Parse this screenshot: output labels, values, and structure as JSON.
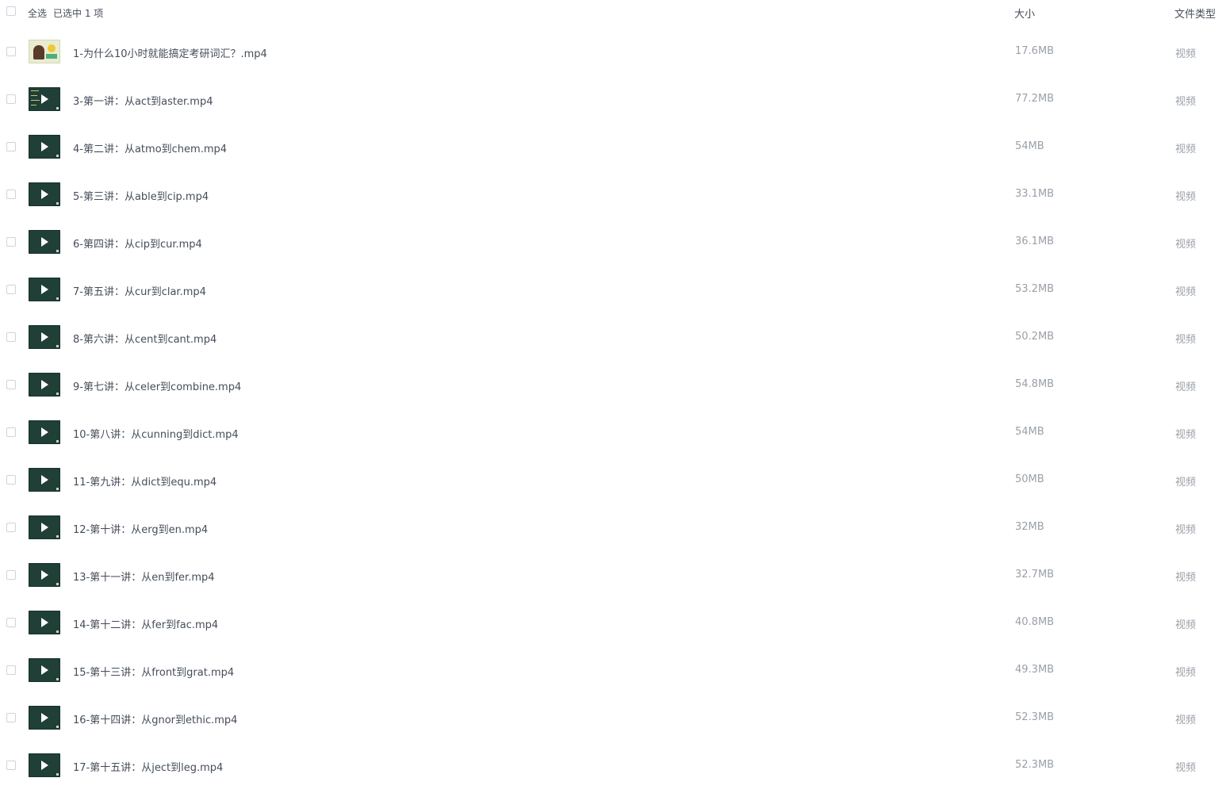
{
  "header": {
    "select_all_label": "全选",
    "selected_text": "已选中  1  项",
    "col_size": "大小",
    "col_type": "文件类型"
  },
  "files": [
    {
      "name": "1-为什么10小时就能搞定考研词汇？.mp4",
      "size": "17.6MB",
      "type": "视频",
      "thumb": "cover"
    },
    {
      "name": "3-第一讲：从act到aster.mp4",
      "size": "77.2MB",
      "type": "视频",
      "thumb": "video-lines"
    },
    {
      "name": "4-第二讲：从atmo到chem.mp4",
      "size": "54MB",
      "type": "视频",
      "thumb": "video"
    },
    {
      "name": "5-第三讲：从able到cip.mp4",
      "size": "33.1MB",
      "type": "视频",
      "thumb": "video"
    },
    {
      "name": "6-第四讲：从cip到cur.mp4",
      "size": "36.1MB",
      "type": "视频",
      "thumb": "video"
    },
    {
      "name": "7-第五讲：从cur到clar.mp4",
      "size": "53.2MB",
      "type": "视频",
      "thumb": "video"
    },
    {
      "name": "8-第六讲：从cent到cant.mp4",
      "size": "50.2MB",
      "type": "视频",
      "thumb": "video"
    },
    {
      "name": "9-第七讲：从celer到combine.mp4",
      "size": "54.8MB",
      "type": "视频",
      "thumb": "video"
    },
    {
      "name": "10-第八讲：从cunning到dict.mp4",
      "size": "54MB",
      "type": "视频",
      "thumb": "video"
    },
    {
      "name": "11-第九讲：从dict到equ.mp4",
      "size": "50MB",
      "type": "视频",
      "thumb": "video"
    },
    {
      "name": "12-第十讲：从erg到en.mp4",
      "size": "32MB",
      "type": "视频",
      "thumb": "video"
    },
    {
      "name": "13-第十一讲：从en到fer.mp4",
      "size": "32.7MB",
      "type": "视频",
      "thumb": "video"
    },
    {
      "name": "14-第十二讲：从fer到fac.mp4",
      "size": "40.8MB",
      "type": "视频",
      "thumb": "video"
    },
    {
      "name": "15-第十三讲：从front到grat.mp4",
      "size": "49.3MB",
      "type": "视频",
      "thumb": "video"
    },
    {
      "name": "16-第十四讲：从gnor到ethic.mp4",
      "size": "52.3MB",
      "type": "视频",
      "thumb": "video"
    },
    {
      "name": "17-第十五讲：从ject到leg.mp4",
      "size": "52.3MB",
      "type": "视频",
      "thumb": "video"
    }
  ]
}
